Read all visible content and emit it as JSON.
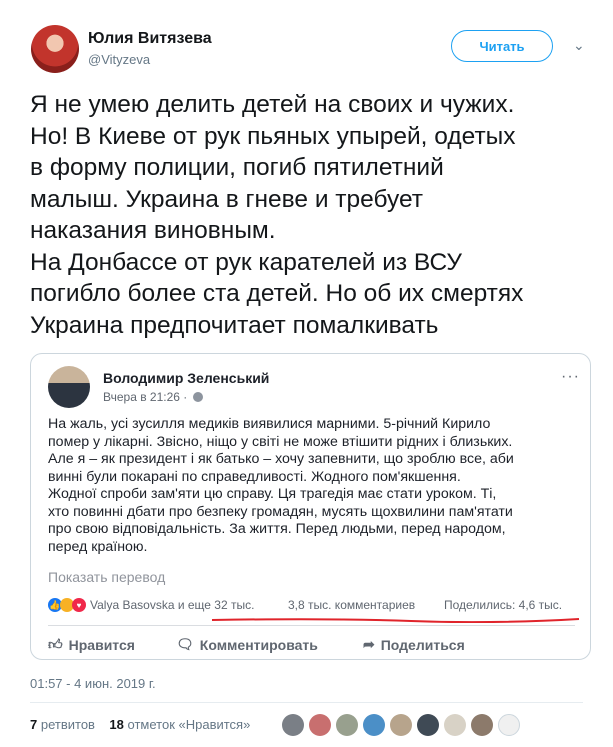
{
  "author": {
    "name": "Юлия Витязева",
    "handle": "@Vityzeva",
    "follow_label": "Читать"
  },
  "tweet": {
    "text": "Я не умею делить детей на своих и чужих.\nНо! В Киеве от рук пьяных упырей, одетых\nв форму полиции, погиб пятилетний\nмалыш. Украина в гневе и требует\nнаказания виновным.\nНа Донбассе от рук карателей из ВСУ\nпогибло более ста детей. Но об их смертях\nУкраина предпочитает помалкивать",
    "timestamp": "01:57 - 4 июн. 2019 г.",
    "retweets_count": "7",
    "retweets_label": "ретвитов",
    "likes_count": "18",
    "likes_label": "отметок «Нравится»"
  },
  "embedded_post": {
    "author": "Володимир Зеленський",
    "time": "Вчера в 21:26 ·",
    "more": "···",
    "text": "На жаль, усі зусилля медиків виявилися марними. 5-річний Кирило\nпомер у лікарні. Звісно, ніщо у світі не може втішити рідних і близьких.\nАле я – як президент і як батько – хочу запевнити, що зроблю все, аби\nвинні були покарані по справедливості. Жодного пом'якшення.\nЖодної спроби зам'яти цю справу. Ця трагедія має стати уроком. Ті,\nхто повинні дбати про безпеку громадян, мусять щохвилини пам'ятати\nпро свою відповідальність. За життя. Перед людьми, перед народом,\nперед країною.",
    "translate_label": "Показать перевод",
    "reactions_text": "Valya Basovska и еще 32 тыс.",
    "comments_text": "3,8 тыс. комментариев",
    "shares_text": "Поделились: 4,6 тыс.",
    "actions": {
      "like": "Нравится",
      "comment": "Комментировать",
      "share": "Поделиться"
    }
  },
  "colors": {
    "accent": "#1da1f2",
    "fb_blue": "#1877f2",
    "underline": "#e0242b"
  }
}
